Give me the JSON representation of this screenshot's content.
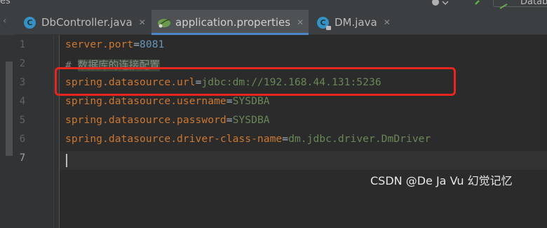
{
  "window": {
    "left_edge_text": "es",
    "database_button_label": "Datab"
  },
  "tabs": [
    {
      "label": "DbController.java",
      "icon": "class-c-icon",
      "active": false
    },
    {
      "label": "application.properties",
      "icon": "spring-leaf-icon",
      "active": true
    },
    {
      "label": "DM.java",
      "icon": "class-c-locked-icon",
      "active": false
    }
  ],
  "editor": {
    "line_numbers": [
      "1",
      "2",
      "3",
      "4",
      "5",
      "6",
      "7"
    ],
    "current_line": "7",
    "lines": [
      {
        "key": "server.port",
        "eq": "=",
        "value": "8081",
        "value_type": "number"
      },
      {
        "comment": "# ",
        "comment_text": "数据库的连接配置"
      },
      {
        "key": "spring.datasource.url",
        "eq": "=",
        "value": "jdbc:dm://192.168.44.131:5236",
        "value_type": "string"
      },
      {
        "key": "spring.datasource.username",
        "eq": "=",
        "value": "SYSDBA",
        "value_type": "string"
      },
      {
        "key": "spring.datasource.password",
        "eq": "=",
        "value": "SYSDBA",
        "value_type": "string"
      },
      {
        "key": "spring.datasource.driver-class-name",
        "eq": "=",
        "value": "dm.jdbc.driver.DmDriver",
        "value_type": "string"
      },
      {
        "key": "",
        "eq": "",
        "value": ""
      }
    ]
  },
  "watermark": "CSDN @De Ja Vu 幻觉记忆",
  "colors": {
    "background": "#2b2b2b",
    "key": "#cc7832",
    "string_value": "#6a8759",
    "number_value": "#6897bb",
    "comment": "#808080",
    "highlight_box": "#e8261f",
    "active_tab_underline": "#4a88c7"
  }
}
